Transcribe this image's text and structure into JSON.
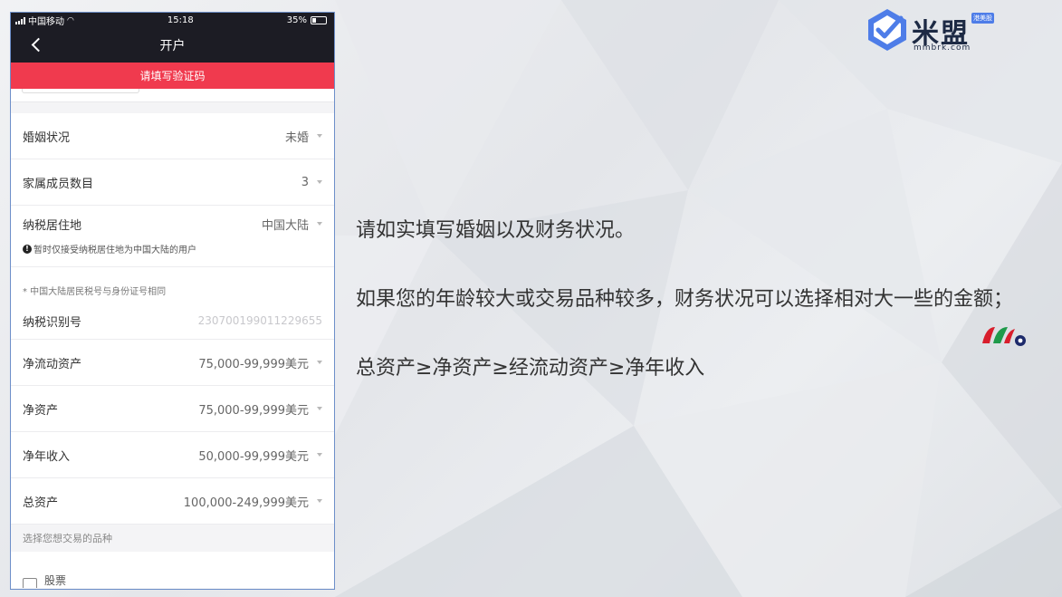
{
  "statusbar": {
    "carrier": "中国移动",
    "time": "15:18",
    "battery": "35%"
  },
  "navbar": {
    "title": "开户"
  },
  "alert": {
    "text": "请填写验证码"
  },
  "form": {
    "rows_top": [
      {
        "label": "婚姻状况",
        "value": "未婚"
      },
      {
        "label": "家属成员数目",
        "value": "3"
      },
      {
        "label": "纳税居住地",
        "value": "中国大陆"
      }
    ],
    "tax_hint": "暂时仅接受纳税居住地为中国大陆的用户",
    "id_note": "* 中国大陆居民税号与身份证号相同",
    "tax_id": {
      "label": "纳税识别号",
      "placeholder": "230700199011229655"
    },
    "rows_assets": [
      {
        "label": "净流动资产",
        "value": "75,000-99,999美元"
      },
      {
        "label": "净资产",
        "value": "75,000-99,999美元"
      },
      {
        "label": "净年收入",
        "value": "50,000-99,999美元"
      },
      {
        "label": "总资产",
        "value": "100,000-249,999美元"
      }
    ],
    "section_header": "选择您想交易的品种",
    "bottom_item": "股票"
  },
  "logo": {
    "name": "米盟",
    "tag": "港美股",
    "url": "mmbrk.com"
  },
  "instructions": {
    "line1": "请如实填写婚姻以及财务状况。",
    "line2": "如果您的年龄较大或交易品种较多，财务状况可以选择相对大一些的金额；",
    "line3": "总资产≥净资产≥经流动资产≥净年收入"
  },
  "colors": {
    "accent_red": "#f03a4e",
    "nav_dark": "#1c1c24",
    "logo_blue": "#4e7de8"
  }
}
